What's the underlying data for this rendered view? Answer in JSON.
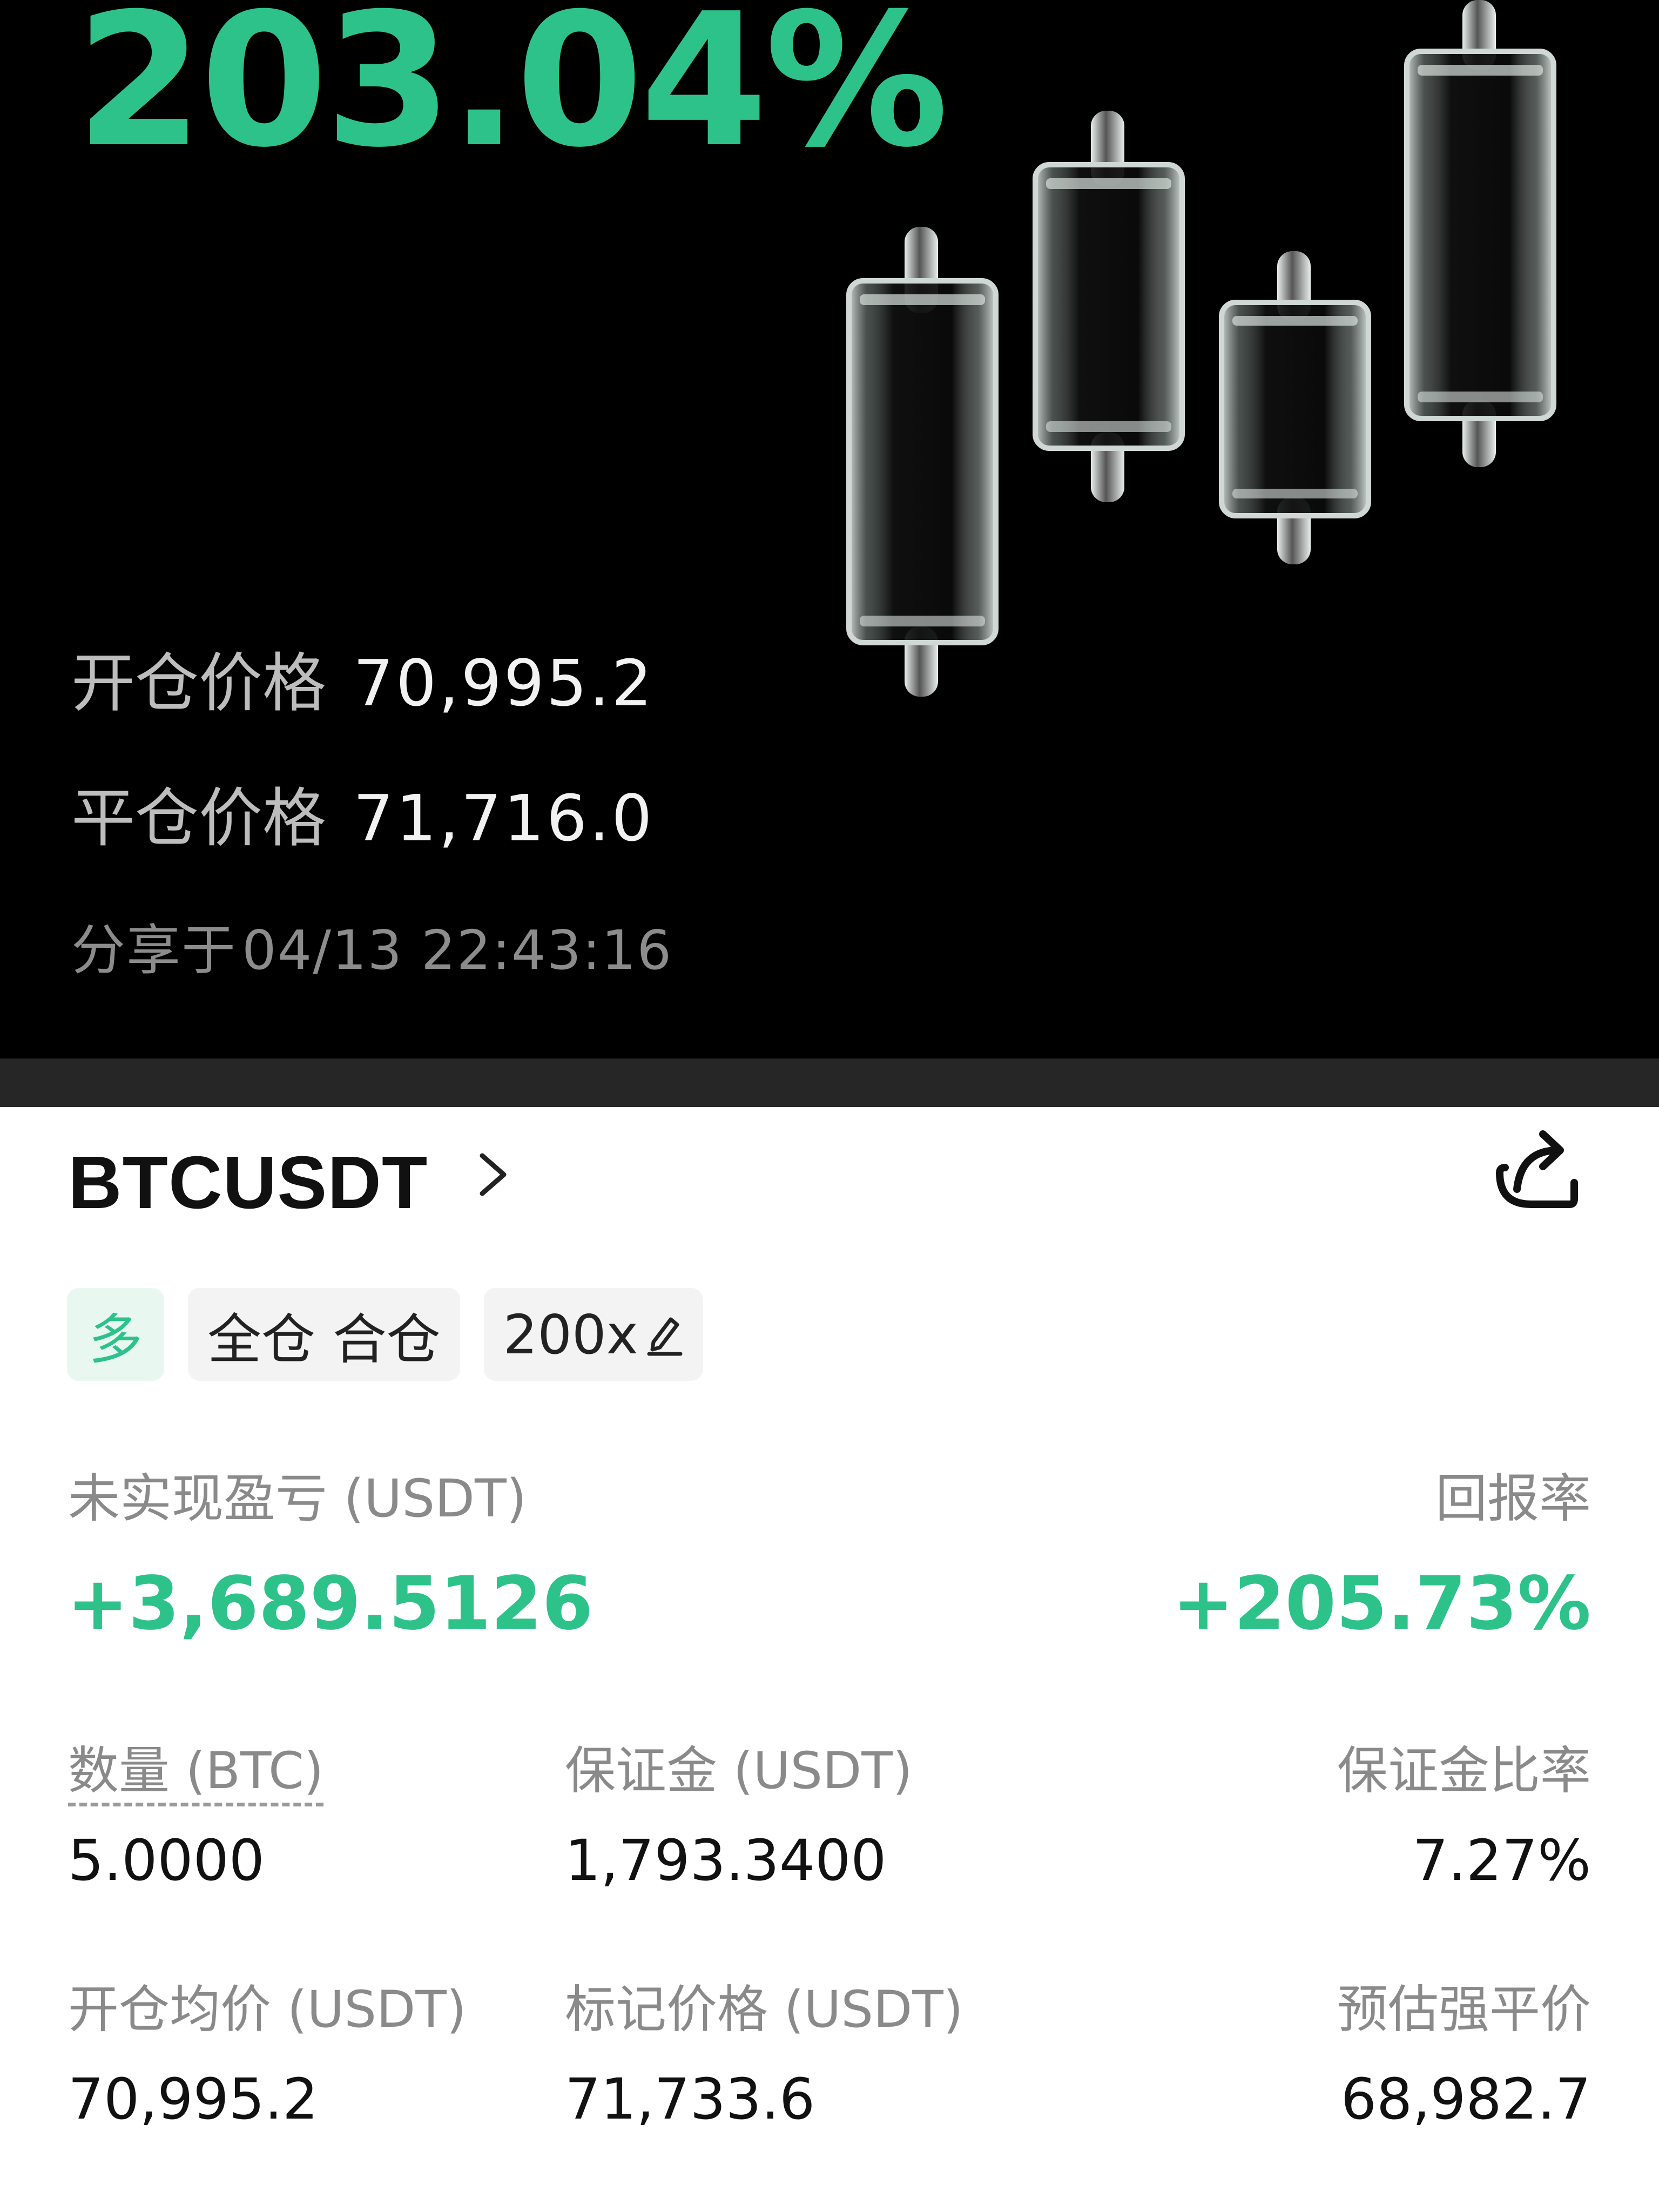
{
  "colors": {
    "profit_green": "#2ec28b",
    "card_bg": "#000000",
    "separator": "#262626",
    "tag_bg": "#f3f3f3",
    "long_tag_bg": "#e8f8f1"
  },
  "share_card": {
    "roi": "203.04%",
    "open_price_label": "开仓价格",
    "open_price_value": "70,995.2",
    "close_price_label": "平仓价格",
    "close_price_value": "71,716.0",
    "shared_label": "分享于",
    "shared_time": "04/13 22:43:16",
    "illustration_icon": "glass-candlesticks-icon"
  },
  "position": {
    "symbol": "BTCUSDT",
    "chevron_icon": "chevron-right-icon",
    "share_icon": "share-icon",
    "tags": {
      "side": "多",
      "margin_mode": "全仓 合仓",
      "leverage": "200x",
      "leverage_edit_icon": "pencil-icon"
    },
    "unrealized_pnl_label": "未实现盈亏 (USDT)",
    "unrealized_pnl_value": "+3,689.5126",
    "roe_label": "回报率",
    "roe_value": "+205.73%",
    "stats": {
      "size_label": "数量 (BTC)",
      "size_value": "5.0000",
      "margin_label": "保证金 (USDT)",
      "margin_value": "1,793.3400",
      "margin_ratio_label": "保证金比率",
      "margin_ratio_value": "7.27%",
      "entry_price_label": "开仓均价 (USDT)",
      "entry_price_value": "70,995.2",
      "mark_price_label": "标记价格 (USDT)",
      "mark_price_value": "71,733.6",
      "liq_price_label": "预估强平价",
      "liq_price_value": "68,982.7"
    }
  }
}
